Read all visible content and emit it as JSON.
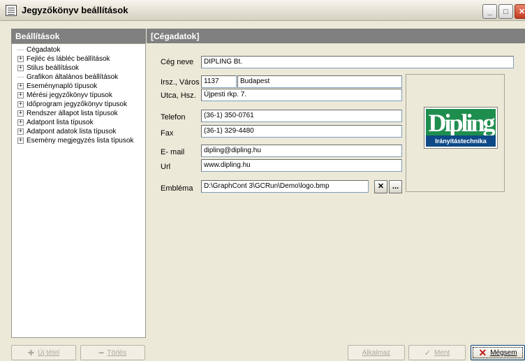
{
  "window": {
    "title": "Jegyzőkönyv beállítások"
  },
  "left_panel": {
    "header": "Beállítások",
    "tree": [
      {
        "label": "Cégadatok",
        "expandable": false
      },
      {
        "label": "Fejléc és lábléc beállítások",
        "expandable": true
      },
      {
        "label": "Stilus beállítások",
        "expandable": true
      },
      {
        "label": "Grafikon általános beállítások",
        "expandable": false
      },
      {
        "label": "Eseménynapló típusok",
        "expandable": true
      },
      {
        "label": "Mérési jegyzőkönyv típusok",
        "expandable": true
      },
      {
        "label": "Időprogram jegyzőkönyv típusok",
        "expandable": true
      },
      {
        "label": "Rendszer állapot lista típusok",
        "expandable": true
      },
      {
        "label": "Adatpont lista típusok",
        "expandable": true
      },
      {
        "label": "Adatpont adatok lista típusok",
        "expandable": true
      },
      {
        "label": "Esemény megjegyzés lista típusok",
        "expandable": true
      }
    ]
  },
  "right_panel": {
    "header": "[Cégadatok]",
    "form": {
      "company_name_label": "Cég neve",
      "company_name": "DIPLING Bt.",
      "zip_city_label": "Irsz., Város",
      "zip": "1137",
      "city": "Budapest",
      "street_label": "Utca, Hsz.",
      "street": "Újpesti rkp. 7.",
      "phone_label": "Telefon",
      "phone": "(36-1) 350-0761",
      "fax_label": "Fax",
      "fax": "(36-1) 329-4480",
      "email_label": "E- mail",
      "email": "dipling@dipling.hu",
      "url_label": "Url",
      "url": "www.dipling.hu",
      "emblem_label": "Embléma",
      "emblem_path": "D:\\GraphCont 3\\GCRun\\Demo\\logo.bmp",
      "clear_button": "✕",
      "browse_button": "..."
    },
    "logo": {
      "word": "Dipling",
      "subtitle": "Irányítástechnika"
    }
  },
  "buttons": {
    "new": "Új tétel",
    "delete": "Törlés",
    "apply": "Alkalmaz",
    "save": "Ment",
    "cancel": "Mégsem"
  },
  "colors": {
    "header_bg": "#808080",
    "logo_green": "#1e8e4f",
    "logo_blue": "#0e4a87"
  },
  "icons": {
    "new": "plus-icon",
    "delete": "minus-icon",
    "save": "checkmark-icon",
    "cancel": "x-icon"
  }
}
